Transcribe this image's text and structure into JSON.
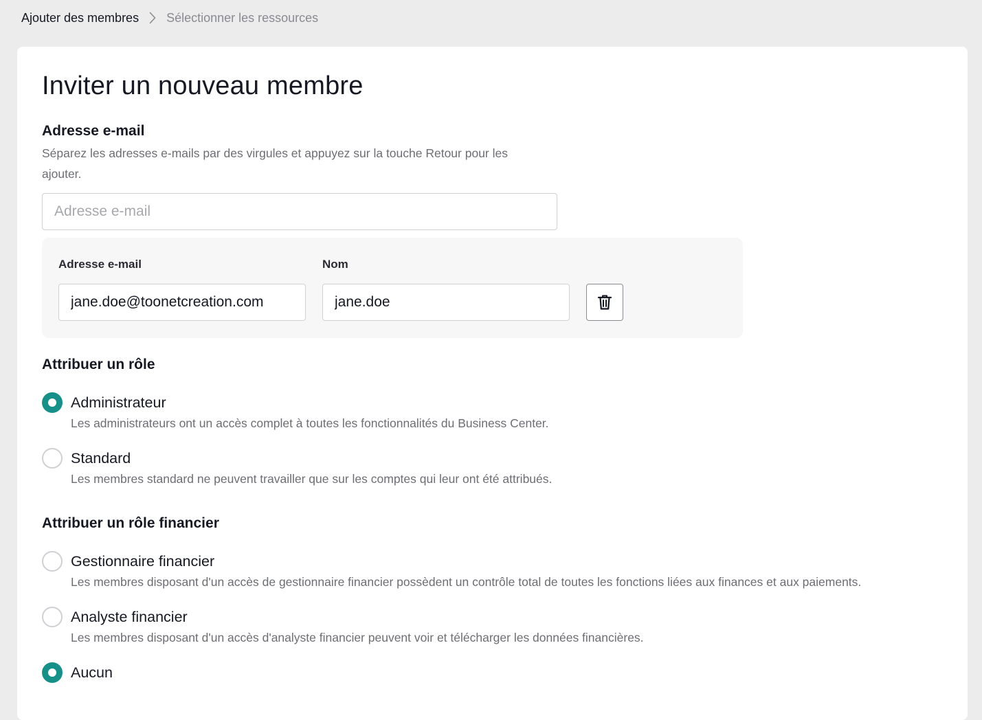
{
  "breadcrumb": {
    "current": "Ajouter des membres",
    "next": "Sélectionner les ressources"
  },
  "page_title": "Inviter un nouveau membre",
  "email_section": {
    "title": "Adresse e-mail",
    "help": "Séparez les adresses e-mails par des virgules et appuyez sur la touche Retour pour les ajouter.",
    "input_placeholder": "Adresse e-mail",
    "input_value": ""
  },
  "member_row": {
    "email_label": "Adresse e-mail",
    "email_value": "jane.doe@toonetcreation.com",
    "name_label": "Nom",
    "name_value": "jane.doe",
    "delete_icon": "trash-icon"
  },
  "role_section": {
    "title": "Attribuer un rôle",
    "options": [
      {
        "label": "Administrateur",
        "description": "Les administrateurs ont un accès complet à toutes les fonctionnalités du Business Center.",
        "checked": true
      },
      {
        "label": "Standard",
        "description": "Les membres standard ne peuvent travailler que sur les comptes qui leur ont été attribués.",
        "checked": false
      }
    ]
  },
  "finance_section": {
    "title": "Attribuer un rôle financier",
    "options": [
      {
        "label": "Gestionnaire financier",
        "description": "Les membres disposant d'un accès de gestionnaire financier possèdent un contrôle total de toutes les fonctions liées aux finances et aux paiements.",
        "checked": false
      },
      {
        "label": "Analyste financier",
        "description": "Les membres disposant d'un accès d'analyste financier peuvent voir et télécharger les données financières.",
        "checked": false
      },
      {
        "label": "Aucun",
        "description": "",
        "checked": true
      }
    ]
  },
  "colors": {
    "accent": "#16918a",
    "background": "#ececec",
    "card": "#ffffff",
    "muted_text": "#6d6e73"
  }
}
